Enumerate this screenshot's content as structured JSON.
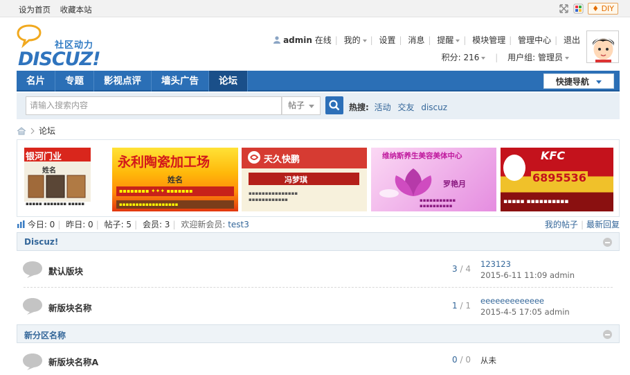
{
  "topbar": {
    "set_home": "设为首页",
    "bookmark": "收藏本站",
    "diy_label": "DIY"
  },
  "logo": {
    "slogan": "社区动力",
    "word": "DISCUZ!"
  },
  "user": {
    "name": "admin",
    "status": "在线",
    "menu": [
      "我的",
      "设置",
      "消息",
      "提醒",
      "模块管理",
      "管理中心",
      "退出"
    ],
    "points_label": "积分: 216",
    "group_label": "用户组: 管理员"
  },
  "nav": {
    "items": [
      "名片",
      "专题",
      "影视点评",
      "墙头广告",
      "论坛"
    ],
    "active_index": 4,
    "quick_nav": "快捷导航"
  },
  "search": {
    "placeholder": "请输入搜索内容",
    "type": "帖子",
    "hot_label": "热搜:",
    "hot_terms": [
      "活动",
      "交友",
      "discuz"
    ]
  },
  "breadcrumb": {
    "current": "论坛"
  },
  "banners": [
    {
      "title": "银河门业",
      "subtitle": "姓名",
      "bg": "#f0ece0"
    },
    {
      "title": "永利陶瓷加工场",
      "subtitle": "姓名",
      "bg": "#e23a1a"
    },
    {
      "title": "天久快鹏",
      "subtitle": "冯梦琪",
      "bg": "#f5f0dc"
    },
    {
      "title": "维纳斯养生美容美体中心",
      "subtitle": "罗艳月",
      "bg": "#f3c6ee"
    },
    {
      "title": "KFC",
      "subtitle": "6895536",
      "bg": "#c4121c"
    }
  ],
  "stats": {
    "today": "今日: 0",
    "yesterday": "昨日: 0",
    "posts": "帖子: 5",
    "members": "会员: 3",
    "welcome": "欢迎新会员:",
    "new_member": "test3",
    "my_posts": "我的帖子",
    "latest": "最新回复"
  },
  "sections": [
    {
      "name": "Discuz!",
      "forums": [
        {
          "name": "默认版块",
          "threads": "3",
          "posts": "4",
          "last_title": "123123",
          "last_info": "2015-6-11 11:09 admin"
        },
        {
          "name": "新版块名称",
          "threads": "1",
          "posts": "1",
          "last_title": "eeeeeeeeeeeee",
          "last_info": "2015-4-5 17:05 admin"
        }
      ]
    },
    {
      "name": "新分区名称",
      "forums": [
        {
          "name": "新版块名称A",
          "threads": "0",
          "posts": "0",
          "last_title": "从未",
          "last_info": ""
        }
      ]
    }
  ]
}
